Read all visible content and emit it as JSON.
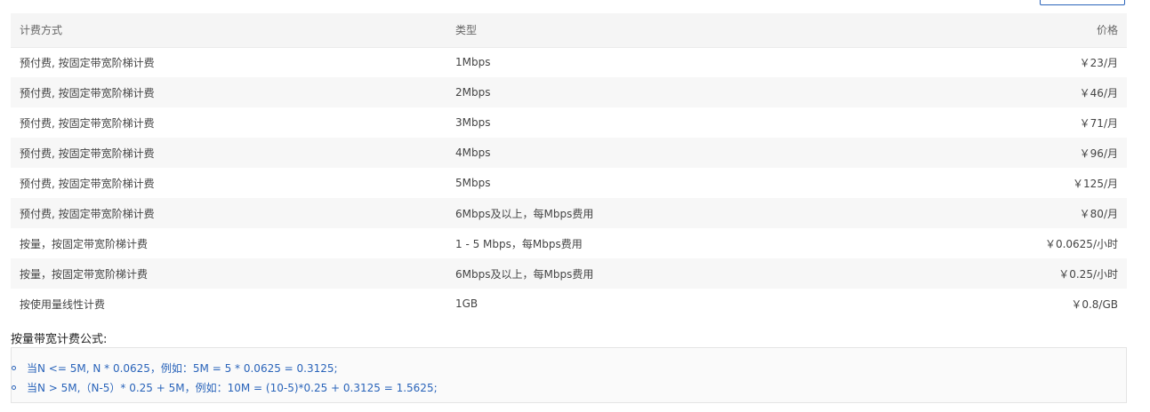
{
  "table": {
    "headers": {
      "method": "计费方式",
      "type": "类型",
      "price": "价格"
    },
    "rows": [
      {
        "method": "预付费, 按固定带宽阶梯计费",
        "type": "1Mbps",
        "price": "￥23/月"
      },
      {
        "method": "预付费, 按固定带宽阶梯计费",
        "type": "2Mbps",
        "price": "￥46/月"
      },
      {
        "method": "预付费, 按固定带宽阶梯计费",
        "type": "3Mbps",
        "price": "￥71/月"
      },
      {
        "method": "预付费, 按固定带宽阶梯计费",
        "type": "4Mbps",
        "price": "￥96/月"
      },
      {
        "method": "预付费, 按固定带宽阶梯计费",
        "type": "5Mbps",
        "price": "￥125/月"
      },
      {
        "method": "预付费, 按固定带宽阶梯计费",
        "type": "6Mbps及以上，每Mbps费用",
        "price": "￥80/月"
      },
      {
        "method": "按量，按固定带宽阶梯计费",
        "type": "1 - 5 Mbps，每Mbps费用",
        "price": "￥0.0625/小时"
      },
      {
        "method": "按量，按固定带宽阶梯计费",
        "type": "6Mbps及以上，每Mbps费用",
        "price": "￥0.25/小时"
      },
      {
        "method": "按使用量线性计费",
        "type": "1GB",
        "price": "￥0.8/GB"
      }
    ]
  },
  "formula": {
    "title": "按量带宽计费公式:",
    "items": [
      "当N <= 5M, N * 0.0625，例如：5M = 5 * 0.0625 = 0.3125;",
      "当N > 5M,（N-5）* 0.25 + 5M，例如：10M = (10-5)*0.25 + 0.3125 = 1.5625;"
    ]
  },
  "colors": {
    "accent": "#2a64ba",
    "header_bg": "#f5f5f5",
    "stripe_bg": "#f7f7f7"
  }
}
